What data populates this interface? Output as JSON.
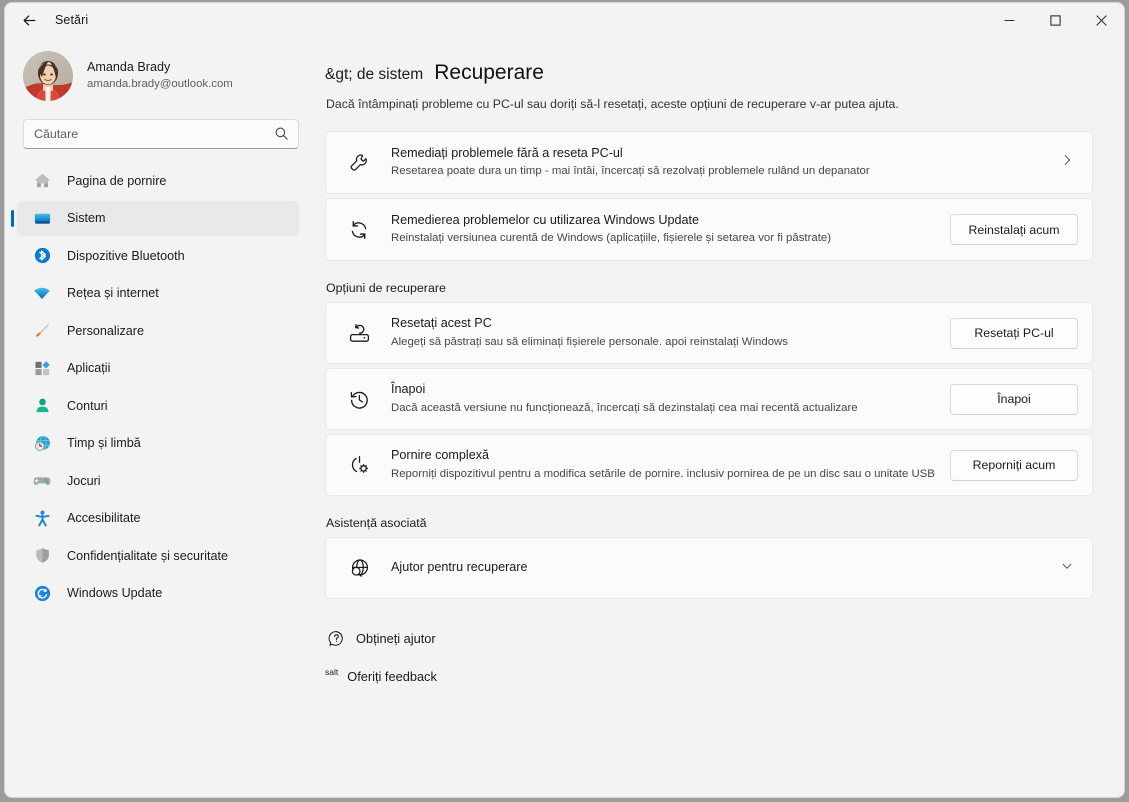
{
  "window": {
    "title": "Setări",
    "back_icon": "back-arrow-icon",
    "minimize": "–",
    "maximize": "□",
    "close": "✕"
  },
  "sidebar": {
    "profile": {
      "name": "Amanda Brady",
      "email": "amanda.brady@outlook.com"
    },
    "search": {
      "placeholder": "Căutare",
      "value": "",
      "icon": "search-icon"
    },
    "items": [
      {
        "label": "Pagina de pornire",
        "icon": "home-icon",
        "active": false
      },
      {
        "label": "Sistem",
        "icon": "monitor-icon",
        "active": true
      },
      {
        "label": "Dispozitive Bluetooth",
        "icon": "bluetooth-icon",
        "active": false
      },
      {
        "label": "Rețea și internet",
        "icon": "wifi-icon",
        "active": false
      },
      {
        "label": "Personalizare",
        "icon": "paintbrush-icon",
        "active": false
      },
      {
        "label": "Aplicații",
        "icon": "apps-icon",
        "active": false
      },
      {
        "label": "Conturi",
        "icon": "person-icon",
        "active": false
      },
      {
        "label": "Timp și limbă",
        "icon": "clock-globe-icon",
        "active": false
      },
      {
        "label": "Jocuri",
        "icon": "gamepad-icon",
        "active": false
      },
      {
        "label": "Accesibilitate",
        "icon": "accessibility-icon",
        "active": false
      },
      {
        "label": "Confidențialitate și securitate",
        "icon": "shield-icon",
        "active": false
      },
      {
        "label": "Windows Update",
        "icon": "update-icon",
        "active": false
      }
    ]
  },
  "main": {
    "breadcrumb_parent": "&gt; de sistem",
    "title": "Recuperare",
    "subtitle": "Dacă întâmpinați probleme cu PC-ul sau doriți să-l resetați, aceste opțiuni de recuperare v-ar putea ajuta.",
    "cards_top": [
      {
        "icon": "wrench-icon",
        "title": "Remediați problemele fără a reseta PC-ul",
        "desc": "Resetarea poate dura un timp - mai întâi, încercați să rezolvați problemele rulând un depanator",
        "trailing": "chevron-right-icon",
        "button": null
      },
      {
        "icon": "refresh-icon",
        "title": "Remedierea problemelor cu utilizarea Windows Update",
        "desc": "Reinstalați versiunea curentă de Windows (aplicațiile, fișierele și setarea vor fi păstrate)",
        "trailing": null,
        "button": "Reinstalați acum"
      }
    ],
    "section_recovery": "Opțiuni de recuperare",
    "cards_recovery": [
      {
        "icon": "reset-pc-icon",
        "title": "Resetați acest PC",
        "desc": "Alegeți să păstrați sau să eliminați fișierele personale. apoi reinstalați Windows",
        "trailing": null,
        "button": "Resetați PC-ul"
      },
      {
        "icon": "history-back-icon",
        "title": "Înapoi",
        "desc": "Dacă această versiune nu funcționează, încercați să dezinstalați cea mai recentă actualizare",
        "trailing": null,
        "button": "Înapoi"
      },
      {
        "icon": "power-gear-icon",
        "title": "Pornire complexă",
        "desc": "Reporniți dispozitivul pentru a modifica setările de pornire. inclusiv pornirea de pe un disc sau o unitate USB",
        "trailing": null,
        "button": "Reporniți acum"
      }
    ],
    "section_support": "Asistență asociată",
    "cards_support": [
      {
        "icon": "globe-search-icon",
        "title": "Ajutor pentru recuperare",
        "desc": null,
        "trailing": "chevron-down-icon",
        "button": null
      }
    ],
    "footer_links": [
      {
        "icon": "question-bubble-icon",
        "prefix": null,
        "label": "Obțineți ajutor"
      },
      {
        "icon": null,
        "prefix": "salt",
        "label": "Oferiți feedback"
      }
    ]
  },
  "colors": {
    "accent": "#0067c0",
    "window_bg": "#f3f3f3",
    "card_bg": "#fbfbfb",
    "card_border": "#e8e8e8"
  }
}
